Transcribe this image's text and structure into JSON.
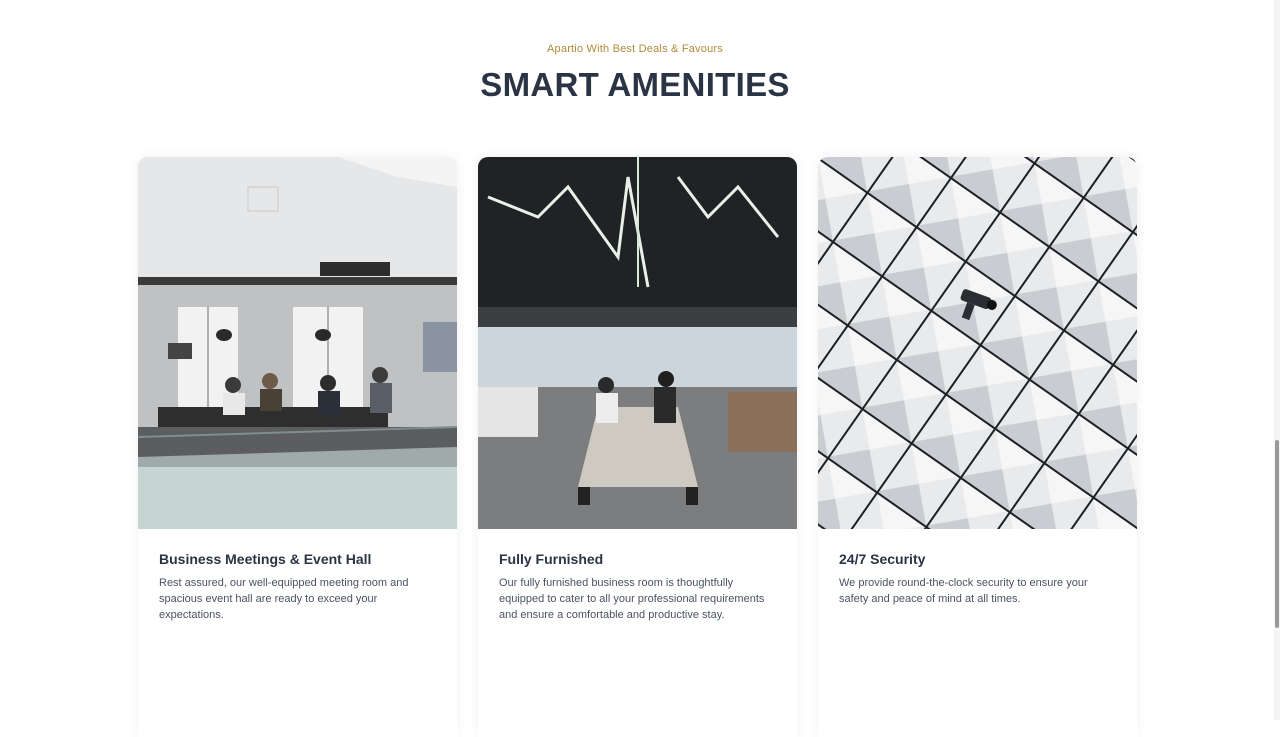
{
  "section": {
    "eyebrow": "Apartio With Best Deals & Favours",
    "title": "SMART AMENITIES"
  },
  "cards": [
    {
      "title": "Business Meetings & Event Hall",
      "text": "Rest assured, our well-equipped meeting room and spacious event hall are ready to exceed your expectations.",
      "image": "meeting-room-photo"
    },
    {
      "title": "Fully Furnished",
      "text": "Our fully furnished business room is thoughtfully equipped to cater to all your professional requirements and ensure a comfortable and productive stay.",
      "image": "open-office-photo"
    },
    {
      "title": "24/7 Security",
      "text": "We provide round-the-clock security to ensure your safety and peace of mind at all times.",
      "image": "security-camera-facade-photo"
    }
  ],
  "colors": {
    "accent": "#b08a3a",
    "heading": "#2b3445",
    "body_text": "#4a5262"
  }
}
